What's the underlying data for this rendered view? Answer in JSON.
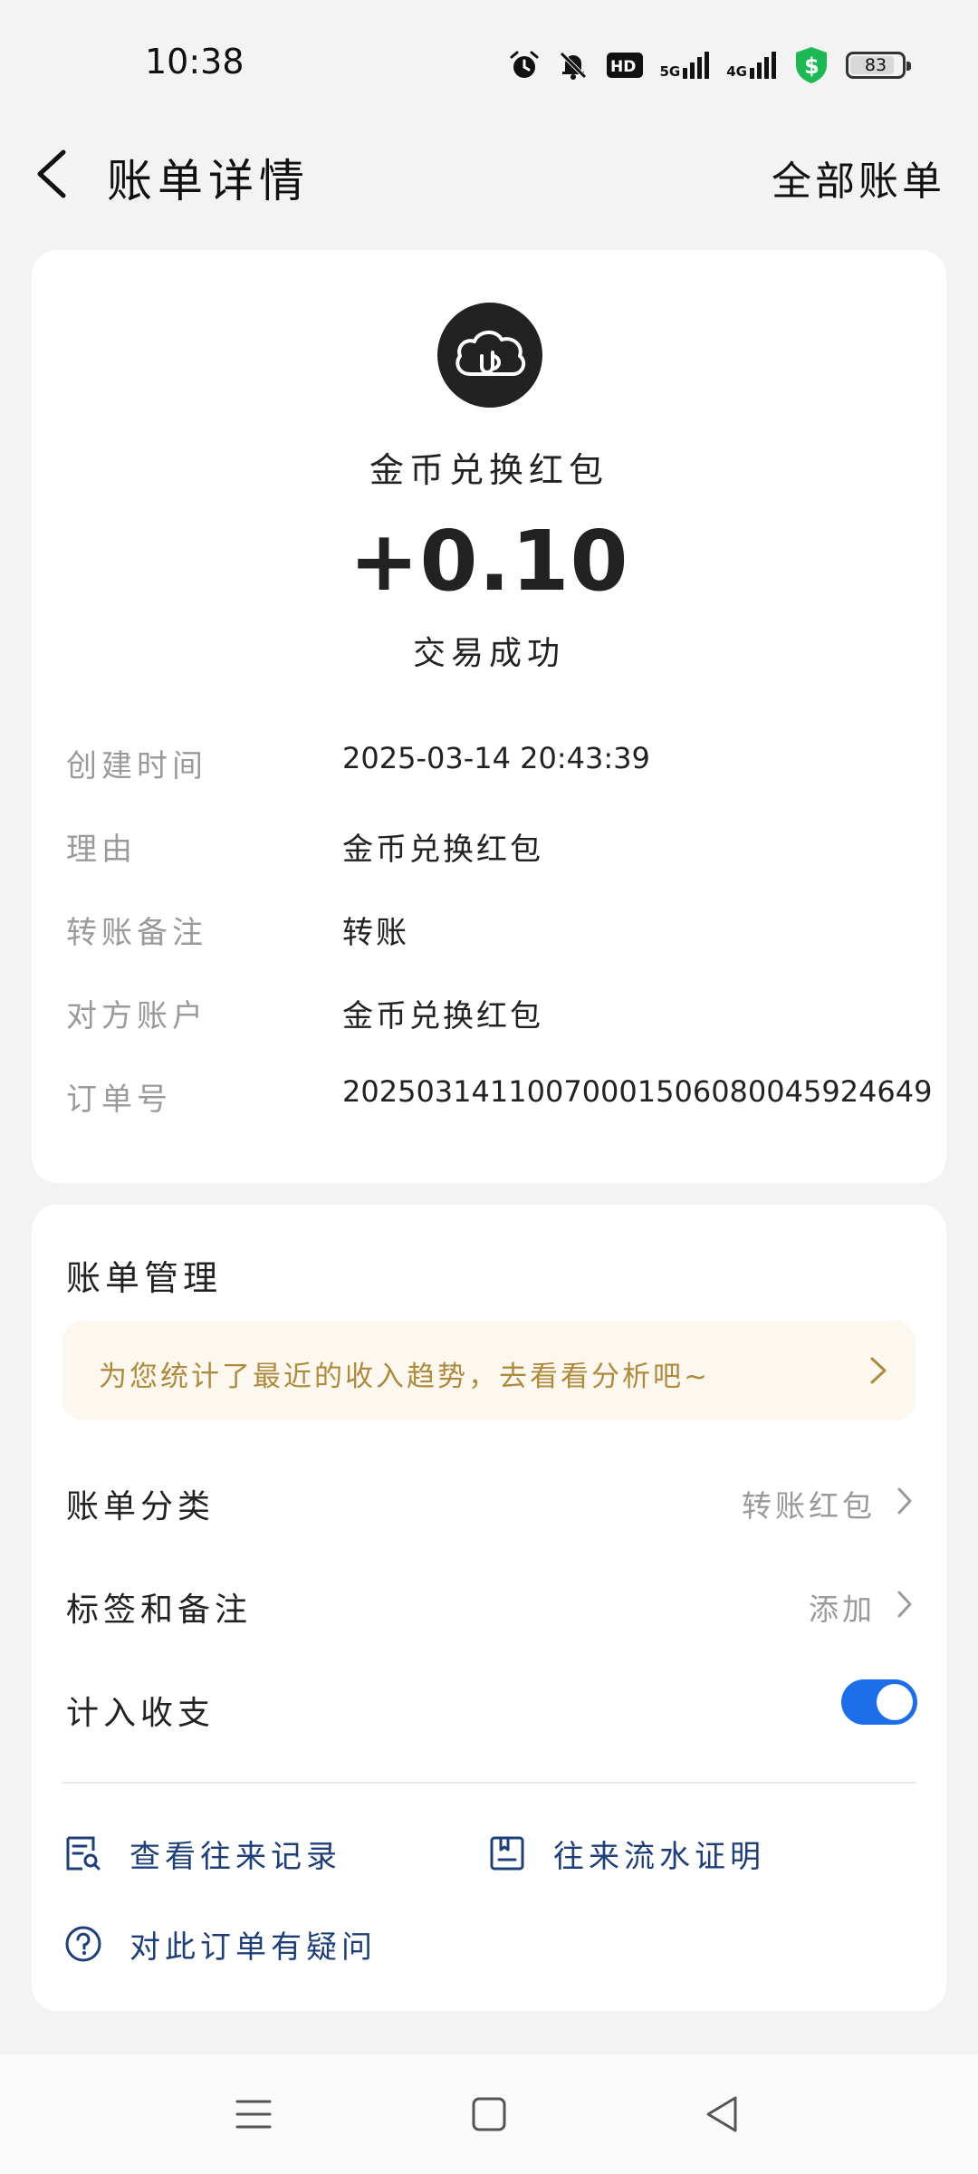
{
  "status_bar": {
    "time": "10:38",
    "net1": "5G",
    "net2": "4G",
    "hd_label": "HD",
    "battery": "83",
    "icons": [
      "alarm-icon",
      "mute-bell-icon",
      "hd-voice-icon",
      "signal-5g-icon",
      "signal-4g-icon",
      "shield-dollar-icon",
      "battery-icon"
    ]
  },
  "header": {
    "title": "账单详情",
    "right_link": "全部账单"
  },
  "transaction": {
    "logo_icon": "cloud-logo-icon",
    "merchant": "金币兑换红包",
    "amount": "+0.10",
    "status": "交易成功",
    "details": [
      {
        "label": "创建时间",
        "value": "2025-03-14 20:43:39"
      },
      {
        "label": "理由",
        "value": "金币兑换红包"
      },
      {
        "label": "转账备注",
        "value": "转账"
      },
      {
        "label": "对方账户",
        "value": "金币兑换红包"
      },
      {
        "label": "订单号",
        "value": "20250314110070001506080045924649"
      }
    ]
  },
  "management": {
    "title": "账单管理",
    "tip": "为您统计了最近的收入趋势，去看看分析吧~",
    "category_label": "账单分类",
    "category_value": "转账红包",
    "tags_label": "标签和备注",
    "tags_value": "添加",
    "count_label": "计入收支",
    "count_enabled": true,
    "actions": {
      "records": "查看往来记录",
      "proof": "往来流水证明",
      "question": "对此订单有疑问"
    }
  },
  "colors": {
    "accent": "#1c6fe8",
    "link": "#1f3f7a",
    "tip_text": "#b08a3c",
    "tip_bg": "#fcf8ef"
  }
}
